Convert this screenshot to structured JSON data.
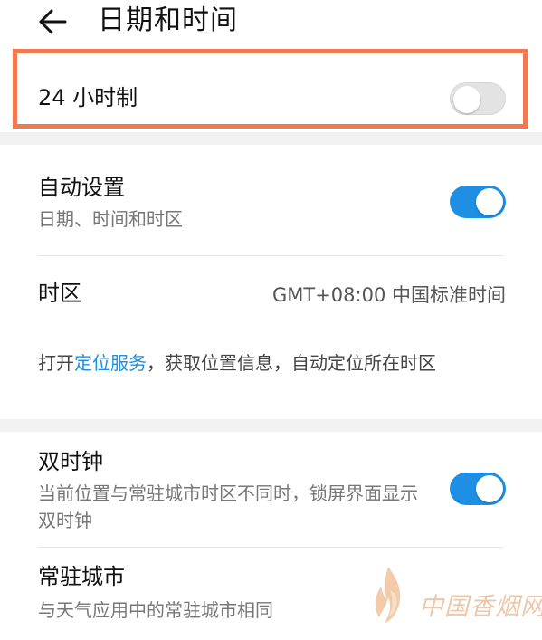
{
  "header": {
    "title": "日期和时间",
    "back_icon": "arrow-left-icon"
  },
  "rows": {
    "hour24": {
      "title": "24 小时制",
      "toggle": "off"
    },
    "auto": {
      "title": "自动设置",
      "subtitle": "日期、时间和时区",
      "toggle": "on"
    },
    "timezone": {
      "title": "时区",
      "value": "GMT+08:00 中国标准时间"
    },
    "location_notice": {
      "prefix": "打开",
      "link": "定位服务",
      "suffix": "，获取位置信息，自动定位所在时区"
    },
    "dual_clock": {
      "title": "双时钟",
      "subtitle": "当前位置与常驻城市时区不同时，锁屏界面显示双时钟",
      "toggle": "on"
    },
    "home_city": {
      "title": "常驻城市",
      "subtitle": "与天气应用中的常驻城市相同"
    }
  },
  "watermark": {
    "text": "中国香烟网"
  },
  "colors": {
    "accent": "#1e8fe3",
    "highlight": "#ef7a50",
    "toggle_off": "#e3e3e3",
    "gap": "#f2f2f2"
  }
}
